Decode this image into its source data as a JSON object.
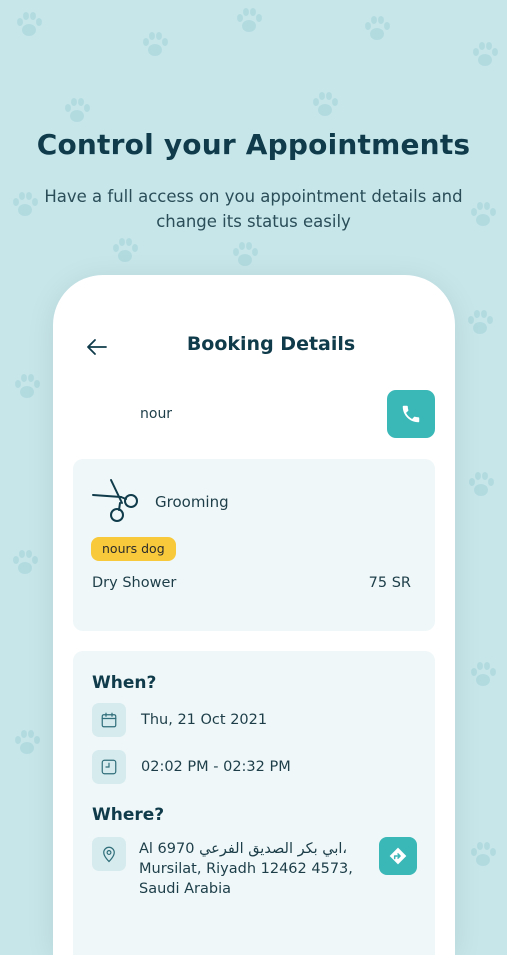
{
  "headline": "Control your Appointments",
  "subtitle": "Have a full access on you appointment details and change its status easily",
  "screen": {
    "title": "Booking Details",
    "customer_name": "nour"
  },
  "service": {
    "name": "Grooming",
    "pet_badge": "nours dog",
    "item_name": "Dry Shower",
    "item_price": "75 SR"
  },
  "when": {
    "title": "When?",
    "date": "Thu, 21 Oct 2021",
    "time": "02:02 PM - 02:32 PM"
  },
  "where": {
    "title": "Where?",
    "address": "Al 6970 ابي بكر الصديق الفرعي، Mursilat, Riyadh 12462 4573, Saudi Arabia"
  },
  "colors": {
    "background": "#c6e6ea",
    "accent": "#3ab7b7",
    "badge": "#f7c93b",
    "card": "#eff7f8",
    "text_dark": "#0f3b4a"
  },
  "icons": [
    "paw-icon",
    "back-arrow-icon",
    "phone-icon",
    "scissors-icon",
    "calendar-icon",
    "clock-icon",
    "location-pin-icon",
    "directions-icon"
  ]
}
